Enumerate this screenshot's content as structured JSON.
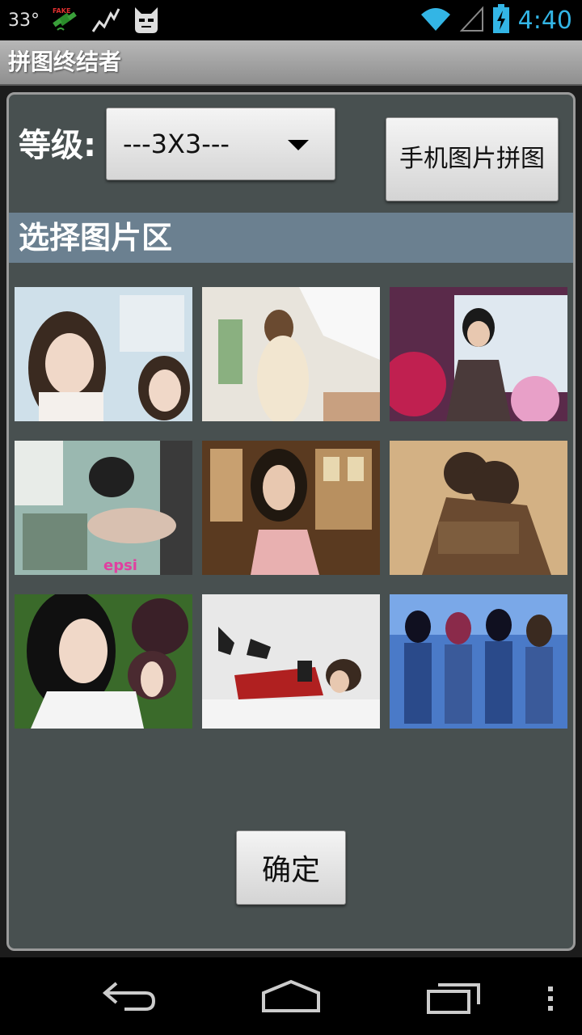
{
  "status_bar": {
    "temperature": "33°",
    "clock": "4:40",
    "icons": [
      "fake-gps-icon",
      "activity-graph-icon",
      "cyanogen-mascot-icon",
      "wifi-icon",
      "signal-icon",
      "battery-charging-icon"
    ],
    "clock_color": "#33b5e5"
  },
  "app": {
    "title": "拼图终结者"
  },
  "controls": {
    "level_label": "等级:",
    "level_selected": "---3X3---",
    "phone_picture_button": "手机图片拼图"
  },
  "section": {
    "title": "选择图片区"
  },
  "gallery": {
    "images": [
      {
        "subject": "woman-with-braids-portrait",
        "palette": [
          "#cfe0ea",
          "#3a2a20",
          "#f0d8c8"
        ]
      },
      {
        "subject": "woman-in-white-room",
        "palette": [
          "#e8e4dc",
          "#6a4a30",
          "#f2e6d0"
        ]
      },
      {
        "subject": "woman-on-stage-purple",
        "palette": [
          "#5a2a4a",
          "#1a1a1a",
          "#e8c8d0"
        ]
      },
      {
        "subject": "woman-at-table-teal",
        "palette": [
          "#9ab8b0",
          "#202020",
          "#d8c0b0"
        ]
      },
      {
        "subject": "woman-in-pink-dress-window",
        "palette": [
          "#5a3a20",
          "#201810",
          "#e8b0b0"
        ]
      },
      {
        "subject": "couple-sepia-album",
        "palette": [
          "#c8a070",
          "#3a2a20",
          "#e8d0a8"
        ]
      },
      {
        "subject": "woman-with-plants-green",
        "palette": [
          "#3a6a2a",
          "#101010",
          "#f0d8c8"
        ]
      },
      {
        "subject": "woman-lying-red-dress",
        "palette": [
          "#e8e8e8",
          "#b02020",
          "#202020"
        ]
      },
      {
        "subject": "four-singers-blue-stage",
        "palette": [
          "#4a7ac8",
          "#2a4a8a",
          "#d8c0b0"
        ]
      }
    ]
  },
  "confirm_button": "确定",
  "nav_bar": {
    "icons": [
      "back-icon",
      "home-icon",
      "recent-apps-icon",
      "menu-icon"
    ]
  }
}
